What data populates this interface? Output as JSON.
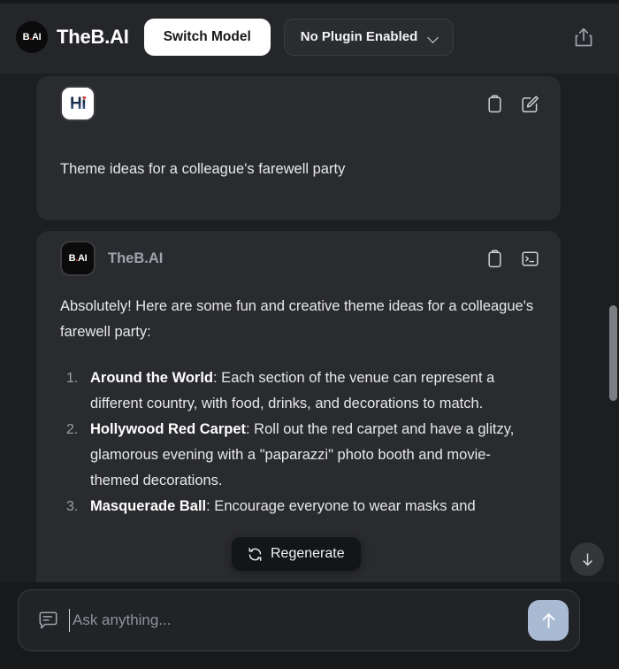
{
  "header": {
    "logo_icon": "theb-ai-circle-logo",
    "logo_text_main": "B",
    "logo_text_dot": ".",
    "logo_text_tail": "AI",
    "brand_name": "TheB.AI",
    "switch_model_label": "Switch Model",
    "plugin_label": "No Plugin Enabled",
    "plugin_chevron_icon": "chevron-down-icon",
    "share_icon": "share-upload-icon"
  },
  "colors": {
    "page_background": "#18191b",
    "conversation_background": "#1d1e20",
    "card_background": "#2a2b2e",
    "header_background": "#25262a",
    "accent_send_button": "#a9bad3",
    "logo_dot_red": "#e03a2f",
    "assistant_name_gray": "#9fa3ab",
    "scrollbar_thumb": "#7d7f84"
  },
  "user_message": {
    "avatar_icon": "hi-avatar-icon",
    "avatar_text": "Hi",
    "copy_icon": "clipboard-copy-icon",
    "edit_icon": "pencil-edit-icon",
    "text": "Theme ideas for a colleague's farewell party"
  },
  "assistant_message": {
    "avatar_icon": "theb-ai-square-logo",
    "avatar_text_main": "B",
    "avatar_text_dot": ".",
    "avatar_text_tail": "AI",
    "name": "TheB.AI",
    "copy_icon": "clipboard-copy-icon",
    "terminal_icon": "terminal-code-icon",
    "intro": "Absolutely! Here are some fun and creative theme ideas for a colleague's farewell party:",
    "list": [
      {
        "title": "Around the World",
        "body": ": Each section of the venue can represent a different country, with food, drinks, and decorations to match."
      },
      {
        "title": "Hollywood Red Carpet",
        "body": ": Roll out the red carpet and have a glitzy, glamorous evening with a \"paparazzi\" photo booth and movie-themed decorations."
      },
      {
        "title": "Masquerade Ball",
        "body": ": Encourage everyone to wear masks and"
      }
    ]
  },
  "regenerate": {
    "icon": "refresh-regenerate-icon",
    "label": "Regenerate"
  },
  "scroll_bottom": {
    "icon": "arrow-down-icon"
  },
  "composer": {
    "chat_icon": "chat-bubble-icon",
    "placeholder": "Ask anything...",
    "value": "",
    "send_icon": "arrow-up-icon"
  }
}
